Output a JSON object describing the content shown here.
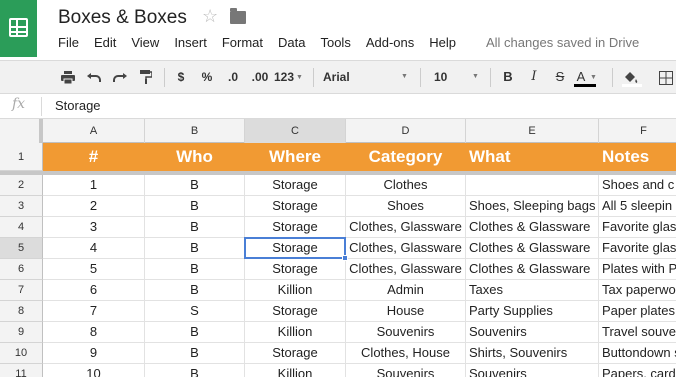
{
  "app": {
    "doc_title": "Boxes & Boxes",
    "save_status": "All changes saved in Drive"
  },
  "menu": [
    "File",
    "Edit",
    "View",
    "Insert",
    "Format",
    "Data",
    "Tools",
    "Add-ons",
    "Help"
  ],
  "toolbar": {
    "currency": "$",
    "percent": "%",
    "dec_decrease": ".0",
    "dec_increase": ".00",
    "more_formats": "123",
    "font": "Arial",
    "font_size": "10",
    "bold": "B",
    "italic": "I",
    "strike": "S",
    "text_color": "A"
  },
  "formula_bar": {
    "fx": "fx",
    "value": "Storage"
  },
  "columns": [
    "A",
    "B",
    "C",
    "D",
    "E",
    "F"
  ],
  "selected_column": "C",
  "selected_row": "5",
  "header_row": {
    "number": "1",
    "cells": [
      "#",
      "Who",
      "Where",
      "Category",
      "What",
      "Notes"
    ]
  },
  "rows": [
    {
      "number": "2",
      "cells": [
        "1",
        "B",
        "Storage",
        "Clothes",
        "",
        "Shoes and c"
      ]
    },
    {
      "number": "3",
      "cells": [
        "2",
        "B",
        "Storage",
        "Shoes",
        "Shoes, Sleeping bags",
        "All 5 sleepin"
      ]
    },
    {
      "number": "4",
      "cells": [
        "3",
        "B",
        "Storage",
        "Clothes, Glassware",
        "Clothes & Glassware",
        "Favorite glas"
      ]
    },
    {
      "number": "5",
      "cells": [
        "4",
        "B",
        "Storage",
        "Clothes, Glassware",
        "Clothes & Glassware",
        "Favorite glas"
      ]
    },
    {
      "number": "6",
      "cells": [
        "5",
        "B",
        "Storage",
        "Clothes, Glassware",
        "Clothes & Glassware",
        "Plates with P"
      ]
    },
    {
      "number": "7",
      "cells": [
        "6",
        "B",
        "Killion",
        "Admin",
        "Taxes",
        "Tax paperwo"
      ]
    },
    {
      "number": "8",
      "cells": [
        "7",
        "S",
        "Storage",
        "House",
        "Party Supplies",
        "Paper plates"
      ]
    },
    {
      "number": "9",
      "cells": [
        "8",
        "B",
        "Killion",
        "Souvenirs",
        "Souvenirs",
        "Travel souve"
      ]
    },
    {
      "number": "10",
      "cells": [
        "9",
        "B",
        "Storage",
        "Clothes, House",
        "Shirts, Souvenirs",
        "Buttondown s"
      ]
    },
    {
      "number": "11",
      "cells": [
        "10",
        "B",
        "Killion",
        "Souvenirs",
        "Souvenirs",
        "Papers, card"
      ]
    }
  ],
  "colors": {
    "header_fill": "#f19a33",
    "logo_green": "#2b9d59",
    "selection_blue": "#4a7fd6"
  }
}
